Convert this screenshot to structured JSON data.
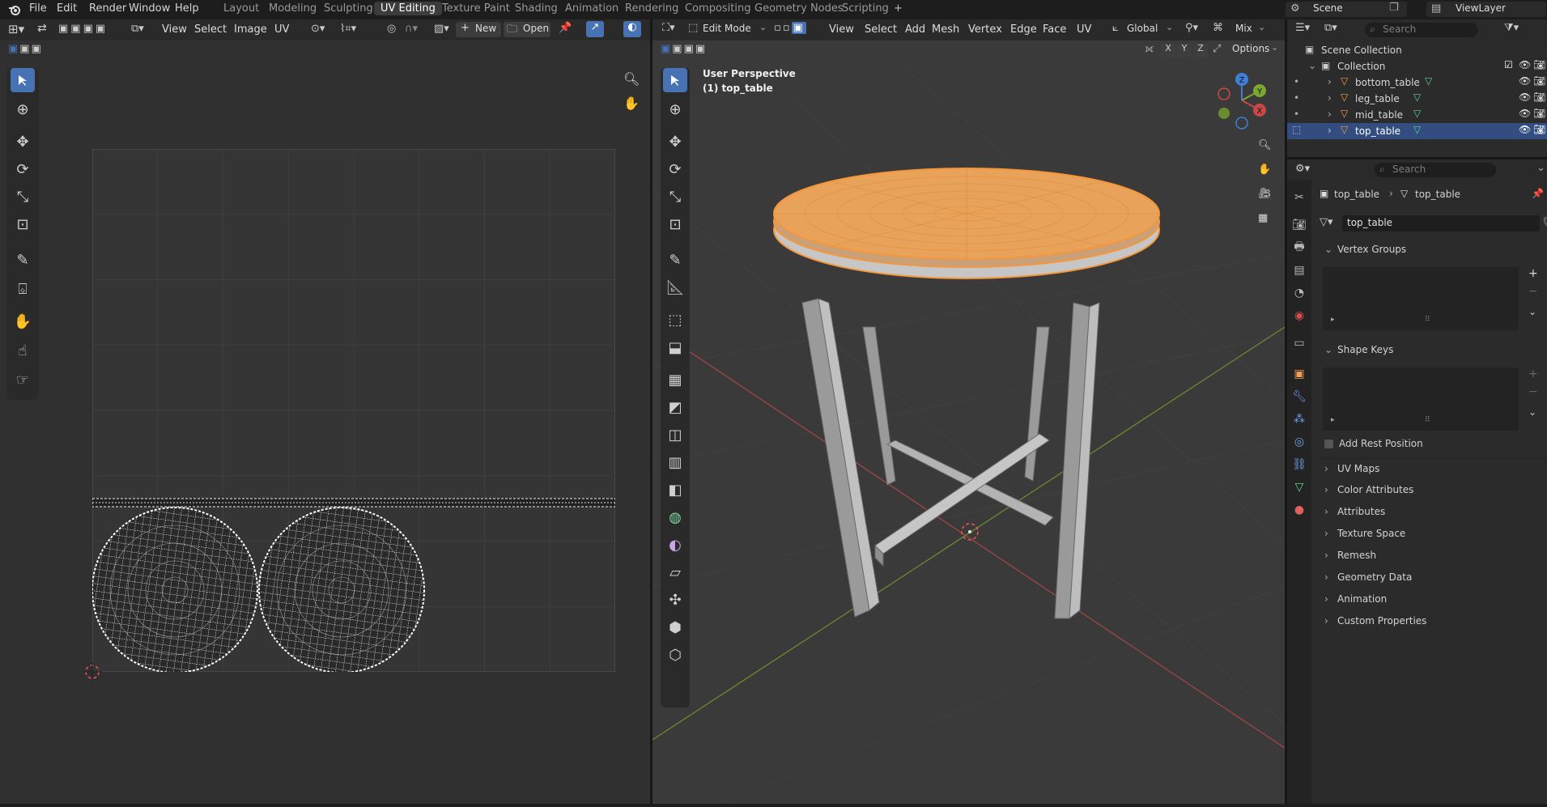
{
  "menubar": {
    "items": [
      "File",
      "Edit",
      "Render",
      "Window",
      "Help"
    ],
    "workspaces": [
      "Layout",
      "Modeling",
      "Sculpting",
      "UV Editing",
      "Texture Paint",
      "Shading",
      "Animation",
      "Rendering",
      "Compositing",
      "Geometry Nodes",
      "Scripting"
    ],
    "active_workspace": "UV Editing",
    "add_tab": "+",
    "scene_label": "Scene",
    "view_layer_label": "ViewLayer"
  },
  "uv_editor": {
    "menus": [
      "View",
      "Select",
      "Image",
      "UV"
    ],
    "new_label": "New",
    "open_label": "Open"
  },
  "viewport": {
    "mode": "Edit Mode",
    "menus": [
      "View",
      "Select",
      "Add",
      "Mesh",
      "Vertex",
      "Edge",
      "Face",
      "UV"
    ],
    "transform_orientation": "Global",
    "pivot": "Mix",
    "options_label": "Options",
    "axis_x": "X",
    "axis_y": "Y",
    "axis_z": "Z",
    "perspective": "User Perspective",
    "object_name": "(1) top_table",
    "gizmo_z": "Z",
    "gizmo_y": "Y",
    "gizmo_x": "X"
  },
  "outliner": {
    "search_placeholder": "Search",
    "scene_collection": "Scene Collection",
    "collection": "Collection",
    "objects": [
      "bottom_table",
      "leg_table",
      "mid_table",
      "top_table"
    ],
    "selected": "top_table"
  },
  "properties": {
    "search_placeholder": "Search",
    "breadcrumb_object": "top_table",
    "breadcrumb_mesh": "top_table",
    "mesh_name": "top_table",
    "sections_open": [
      "Vertex Groups",
      "Shape Keys"
    ],
    "add_rest_position": "Add Rest Position",
    "sections_closed": [
      "UV Maps",
      "Color Attributes",
      "Attributes",
      "Texture Space",
      "Remesh",
      "Geometry Data",
      "Animation",
      "Custom Properties"
    ]
  },
  "colors": {
    "accent": "#4772b3",
    "selection": "#f5973a",
    "x_axis": "#c84848",
    "y_axis": "#7ba830",
    "z_axis": "#3f7fd8"
  }
}
